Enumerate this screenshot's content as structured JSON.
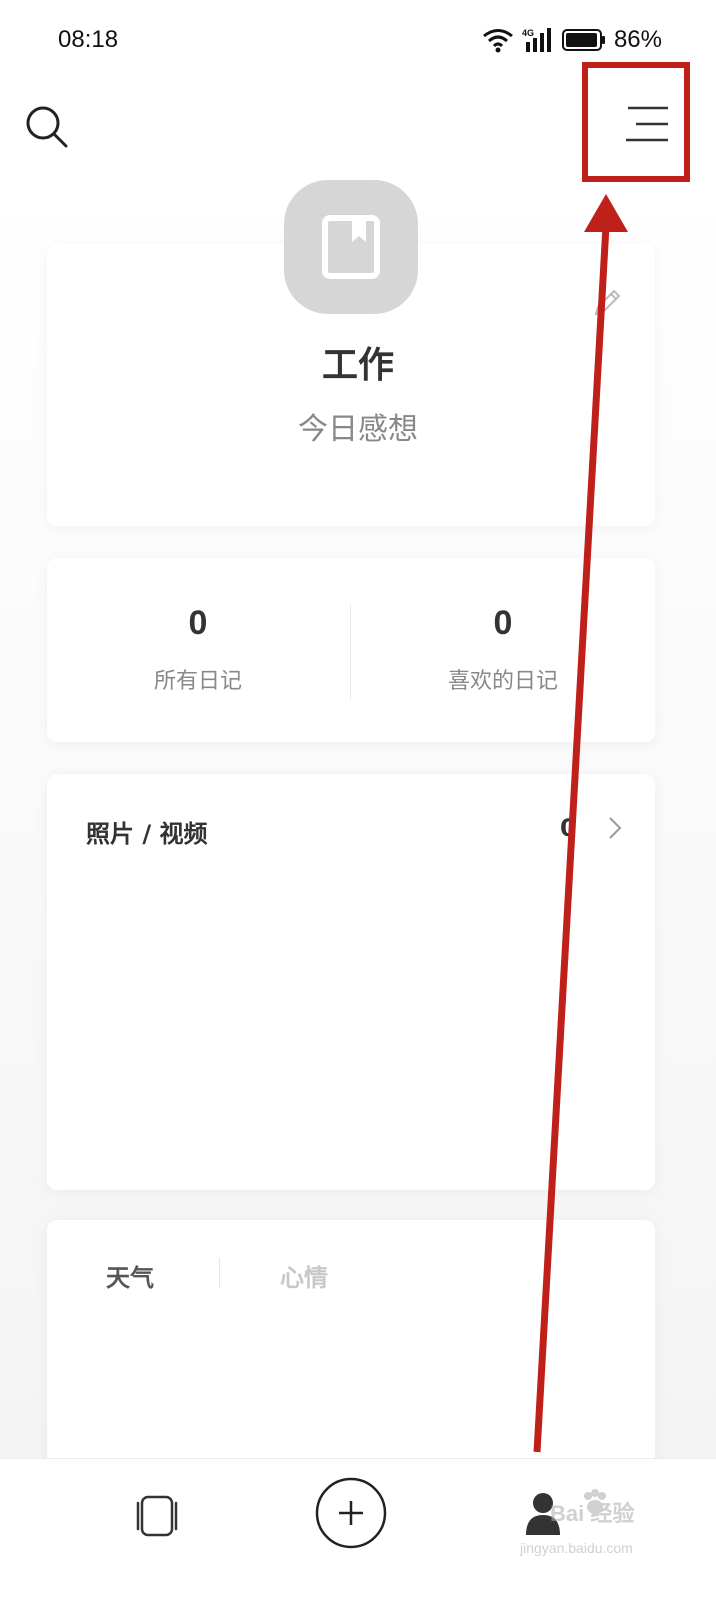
{
  "status_bar": {
    "time": "08:18",
    "network": "4G",
    "battery": "86%"
  },
  "header": {
    "search_icon": "search-icon",
    "menu_icon": "menu-icon"
  },
  "profile": {
    "icon": "notebook-icon",
    "title": "工作",
    "subtitle": "今日感想"
  },
  "stats": {
    "all_diaries": {
      "value": "0",
      "label": "所有日记"
    },
    "liked_diaries": {
      "value": "0",
      "label": "喜欢的日记"
    }
  },
  "media": {
    "title": "照片 / 视频",
    "count": "0"
  },
  "weather_mood": {
    "tab_weather": "天气",
    "tab_mood": "心情"
  },
  "bottom_nav": {
    "items": [
      "cards-icon",
      "add-icon",
      "profile-icon"
    ]
  },
  "watermark": {
    "brand": "Bai 经验",
    "site": "jingyan.baidu.com"
  },
  "annotation": {
    "color": "#c0201a"
  }
}
